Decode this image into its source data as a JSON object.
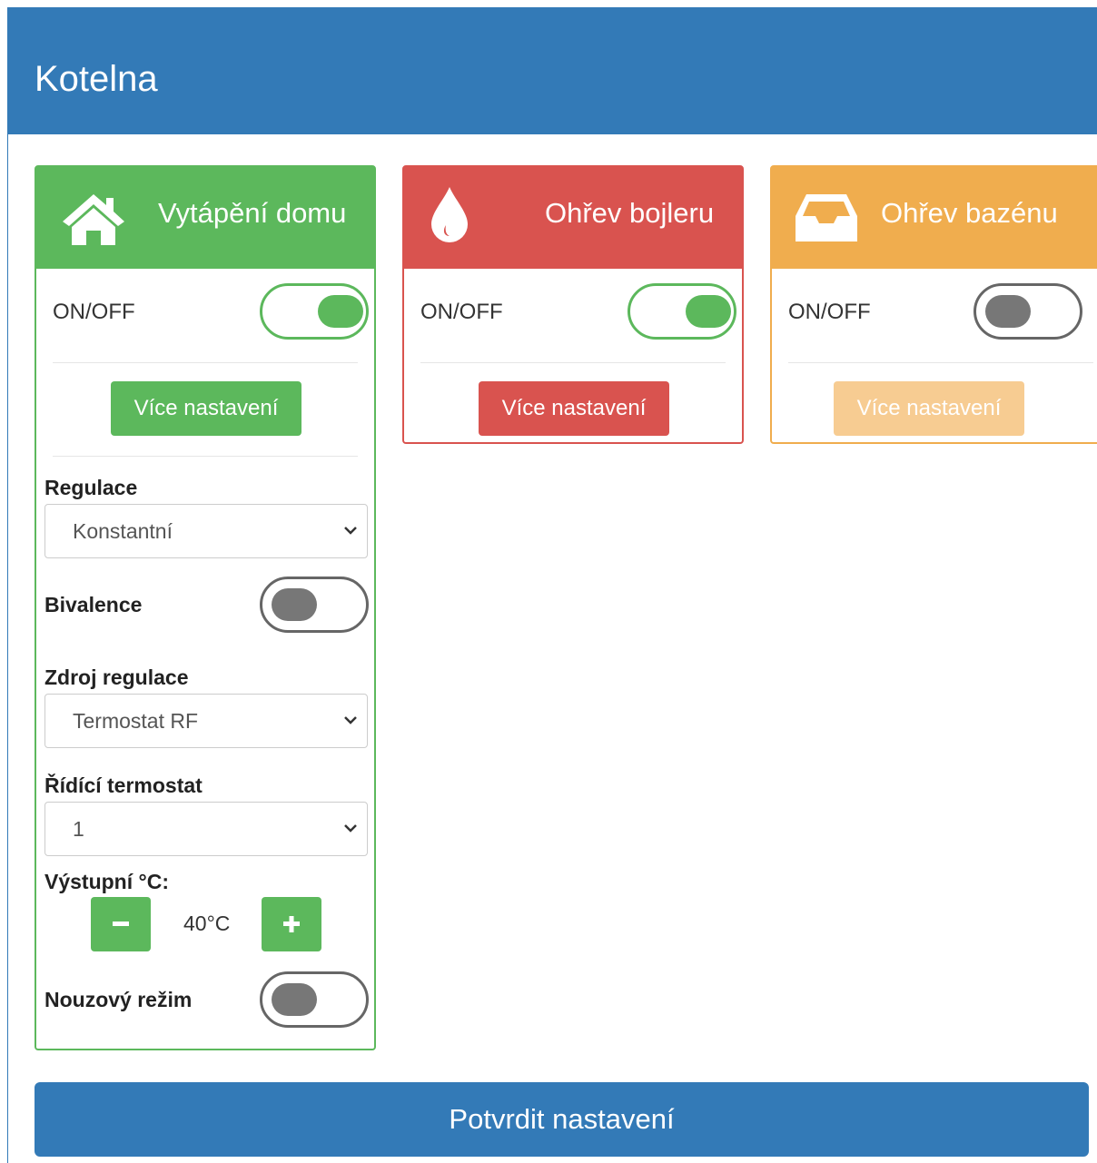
{
  "app": {
    "title": "Kotelna"
  },
  "cards": [
    {
      "title": "Vytápění domu",
      "icon": "home-icon",
      "color": "#5cb85c",
      "onoff_label": "ON/OFF",
      "enabled": true,
      "more_label": "Více nastavení"
    },
    {
      "title": "Ohřev bojleru",
      "icon": "water-drop-icon",
      "color": "#d9534f",
      "onoff_label": "ON/OFF",
      "enabled": true,
      "more_label": "Více nastavení"
    },
    {
      "title": "Ohřev bazénu",
      "icon": "inbox-tray-icon",
      "color": "#f0ad4e",
      "onoff_label": "ON/OFF",
      "enabled": false,
      "more_label": "Více nastavení"
    }
  ],
  "heating_settings": {
    "regulation": {
      "label": "Regulace",
      "value": "Konstantní"
    },
    "bivalence": {
      "label": "Bivalence",
      "enabled": false
    },
    "regulation_source": {
      "label": "Zdroj regulace",
      "value": "Termostat RF"
    },
    "control_thermostat": {
      "label": "Řídící termostat",
      "value": "1"
    },
    "output_temp": {
      "label": "Výstupní °C:",
      "value": "40°C"
    },
    "emergency_mode": {
      "label": "Nouzový režim",
      "enabled": false
    }
  },
  "confirm_label": "Potvrdit nastavení",
  "colors": {
    "primary": "#337ab7",
    "success": "#5cb85c",
    "danger": "#d9534f",
    "warning": "#f0ad4e"
  }
}
